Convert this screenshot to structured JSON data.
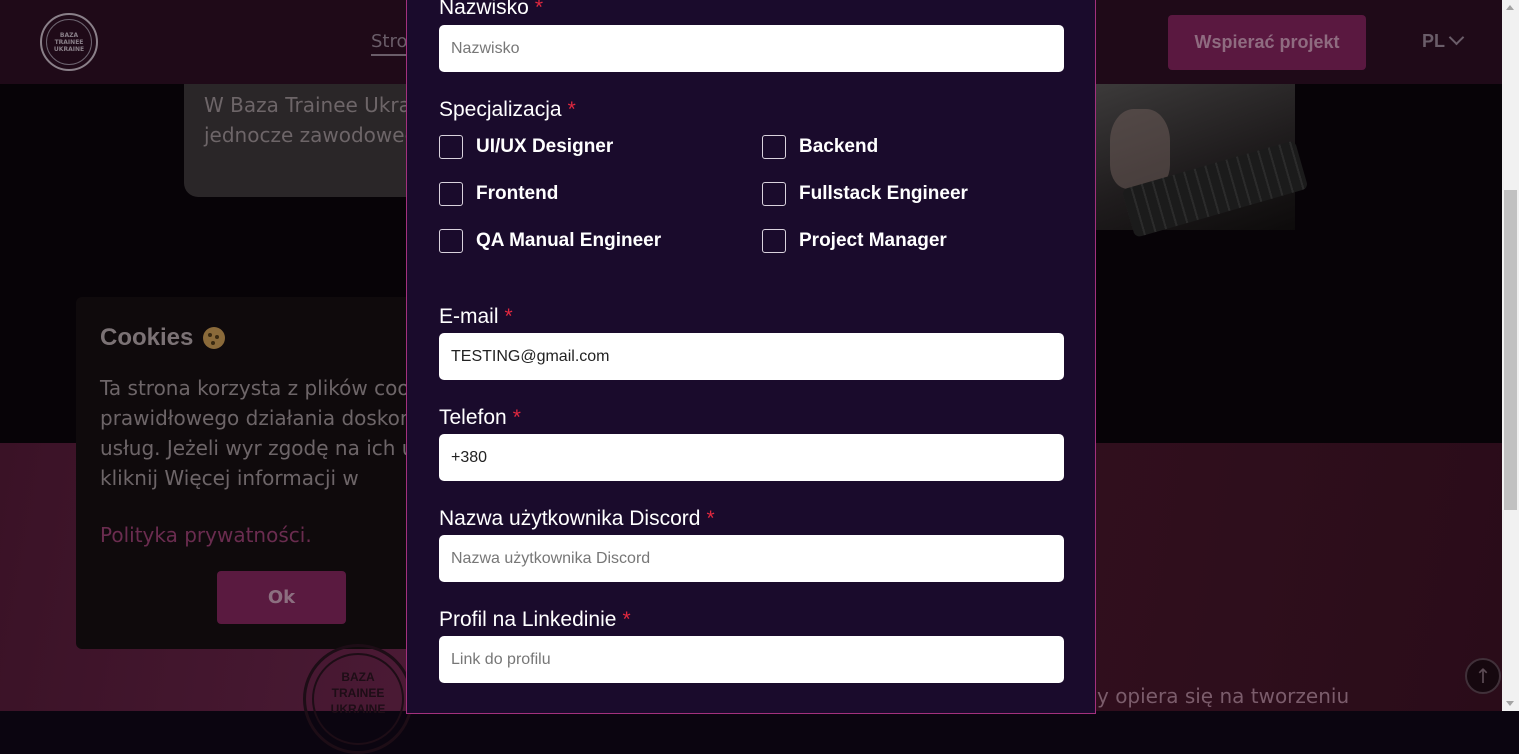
{
  "header": {
    "logo_text": "BAZA\nTRAINEE\nUKRAINE",
    "nav_home": "Stro",
    "support_button": "Wspierać projekt",
    "language": "PL"
  },
  "background": {
    "info_text": "W Baza Trainee Ukra zespołem jednocze zawodowego.",
    "cookies": {
      "title": "Cookies",
      "text": "Ta strona korzysta z plików coo w celu prawidłowego działania doskonalenia usług. Jeżeli wyr zgodę na ich używanie kliknij Więcej informacji w",
      "policy_link": "Polityka prywatności.",
      "ok_button": "Ok"
    },
    "footer_logo_text": "BAZA\nTRAINEE\nUKRAINE",
    "bottom_text": "y opiera się na tworzeniu"
  },
  "form": {
    "surname": {
      "label": "Nazwisko",
      "required": "*",
      "placeholder": "Nazwisko",
      "value": ""
    },
    "specialization": {
      "label": "Specjalizacja",
      "required": "*",
      "options": [
        {
          "label": "UI/UX Designer",
          "checked": false
        },
        {
          "label": "Backend",
          "checked": false
        },
        {
          "label": "Frontend",
          "checked": false
        },
        {
          "label": "Fullstack Engineer",
          "checked": false
        },
        {
          "label": "QA Manual Engineer",
          "checked": false
        },
        {
          "label": "Project Manager",
          "checked": false
        }
      ]
    },
    "email": {
      "label": "E-mail",
      "required": "*",
      "value": "TESTING@gmail.com"
    },
    "phone": {
      "label": "Telefon",
      "required": "*",
      "value": "+380"
    },
    "discord": {
      "label": "Nazwa użytkownika Discord",
      "required": "*",
      "placeholder": "Nazwa użytkownika Discord",
      "value": ""
    },
    "linkedin": {
      "label": "Profil na Linkedinie",
      "required": "*",
      "placeholder": "Link do profilu",
      "value": ""
    }
  },
  "colors": {
    "modal_bg": "#1a0b2c",
    "modal_border": "#a3317e",
    "required_star": "#e0283f",
    "accent": "#5a1840"
  },
  "icons": {
    "scroll_top": "arrow-up-icon",
    "cookie": "cookie-icon",
    "language_chevron": "chevron-down-icon"
  }
}
